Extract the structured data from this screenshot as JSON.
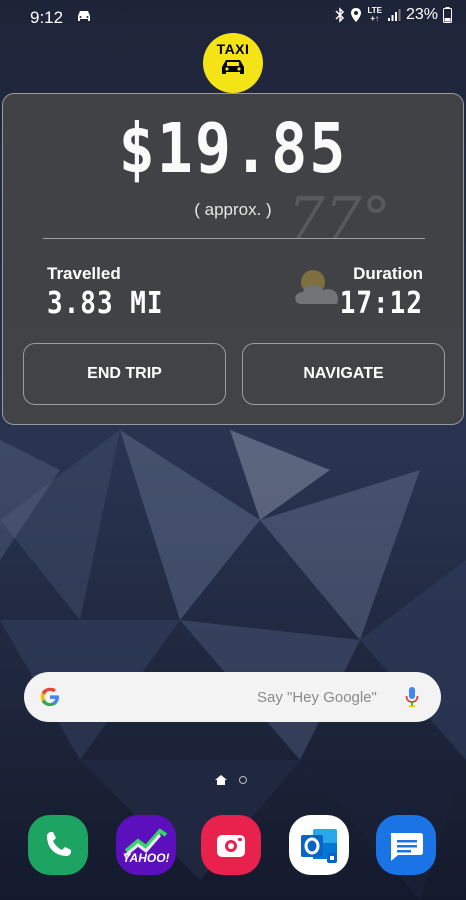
{
  "status_bar": {
    "time": "9:12",
    "battery": "23%",
    "network_top": "LTE",
    "network_bottom": "+↑"
  },
  "taxi_widget": {
    "logo_text": "TAXI",
    "fare": "$19.85",
    "approx_label": "( approx. )",
    "weather_temp": "77°",
    "travelled_label": "Travelled",
    "travelled_value": "3.83 MI",
    "duration_label": "Duration",
    "duration_value": "17:12",
    "end_trip_label": "END TRIP",
    "navigate_label": "NAVIGATE"
  },
  "search": {
    "hint": "Say \"Hey Google\""
  },
  "dock": {
    "yahoo_label": "YAHOO!"
  },
  "colors": {
    "taxi_yellow": "#f4e415",
    "phone": "#1ea462",
    "yahoo": "#5b0fbd",
    "camera": "#e8214d",
    "outlook": "#0a64c8",
    "messages": "#1b74e6"
  }
}
